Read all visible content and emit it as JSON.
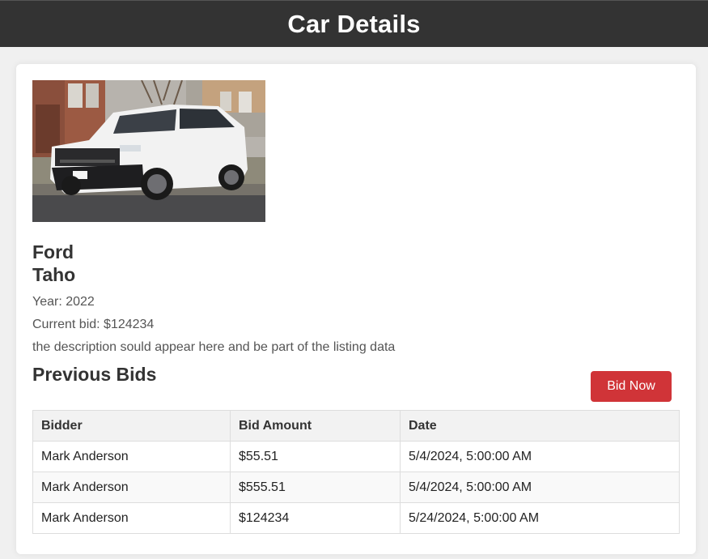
{
  "header": {
    "title": "Car Details"
  },
  "car": {
    "make": "Ford",
    "model": "Taho",
    "year_text": "Year: 2022",
    "current_bid_text": "Current bid: $124234",
    "description": "the description sould appear here and be part of the listing data",
    "photo_icon": "car-photo"
  },
  "bids_section": {
    "title": "Previous Bids",
    "bid_button_label": "Bid Now",
    "columns": [
      "Bidder",
      "Bid Amount",
      "Date"
    ],
    "rows": [
      {
        "bidder": "Mark Anderson",
        "amount": "$55.51",
        "date": "5/4/2024, 5:00:00 AM"
      },
      {
        "bidder": "Mark Anderson",
        "amount": "$555.51",
        "date": "5/4/2024, 5:00:00 AM"
      },
      {
        "bidder": "Mark Anderson",
        "amount": "$124234",
        "date": "5/24/2024, 5:00:00 AM"
      }
    ]
  },
  "colors": {
    "header_bg": "#333333",
    "button_bg": "#d03438",
    "page_bg": "#f0f0f0"
  }
}
